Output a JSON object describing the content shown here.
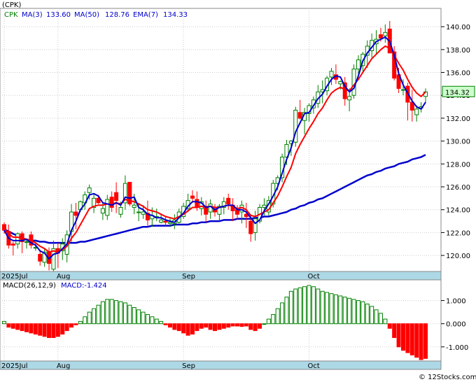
{
  "symbol_label": "(CPK)",
  "legend": {
    "price": {
      "label": "CPK",
      "color": "#008000"
    },
    "ma3": {
      "label": "MA(3)",
      "value": "133.60",
      "color": "#0000cc"
    },
    "ma50": {
      "label": "MA(50)",
      "value": "128.76",
      "color": "#0000cc"
    },
    "ema7": {
      "label": "EMA(7)",
      "value": "134.33",
      "color": "#0000cc"
    }
  },
  "last_price_badge": "134.32",
  "macd_legend": {
    "title": "MACD(26,12,9)",
    "value_label": "MACD:-1.424"
  },
  "watermark": "© 12Stocks.com",
  "colors": {
    "up": "#008000",
    "down": "#ff0000",
    "ma50_line": "#0000cc",
    "ma3_line": "#0000cc",
    "ema7_line": "#ff0000",
    "band": "#add8e6",
    "grid": "#cccccc"
  },
  "chart_data": [
    {
      "type": "candlestick",
      "ylim": [
        118.6,
        141.6
      ],
      "y_ticks": [
        "140.00",
        "138.00",
        "136.00",
        "134.00",
        "132.00",
        "130.00",
        "128.00",
        "126.00",
        "124.00",
        "122.00",
        "120.00"
      ],
      "x_labels": [
        "2025Jul",
        "Aug",
        "Sep",
        "Oct"
      ],
      "x_label_index": [
        0,
        12,
        40,
        68
      ],
      "ohlc": [
        [
          122.7,
          122.9,
          121.9,
          122.2
        ],
        [
          122.1,
          122.7,
          120.6,
          120.9
        ],
        [
          121.0,
          121.2,
          120.0,
          120.9
        ],
        [
          121.0,
          122.0,
          120.6,
          121.9
        ],
        [
          121.9,
          122.1,
          120.2,
          121.2
        ],
        [
          121.2,
          121.5,
          120.6,
          121.2
        ],
        [
          121.8,
          122.1,
          120.6,
          120.9
        ],
        [
          120.7,
          121.3,
          120.4,
          120.7
        ],
        [
          120.1,
          120.5,
          119.1,
          119.5
        ],
        [
          119.4,
          120.6,
          119.0,
          120.3
        ],
        [
          120.3,
          120.7,
          118.7,
          119.3
        ],
        [
          118.8,
          121.3,
          118.5,
          120.6
        ],
        [
          120.6,
          121.1,
          118.9,
          120.2
        ],
        [
          120.4,
          121.5,
          119.6,
          121.0
        ],
        [
          120.1,
          122.2,
          119.4,
          121.8
        ],
        [
          122.1,
          124.5,
          121.2,
          123.8
        ],
        [
          123.8,
          124.6,
          122.3,
          123.5
        ],
        [
          124.0,
          124.8,
          123.8,
          124.7
        ],
        [
          124.6,
          125.6,
          124.0,
          125.3
        ],
        [
          125.5,
          126.2,
          124.9,
          125.9
        ],
        [
          124.2,
          125.4,
          123.7,
          125.0
        ],
        [
          125.0,
          125.3,
          124.5,
          124.6
        ],
        [
          123.7,
          124.6,
          123.1,
          124.1
        ],
        [
          123.5,
          125.3,
          123.1,
          124.9
        ],
        [
          125.1,
          125.6,
          123.8,
          124.2
        ],
        [
          125.5,
          126.4,
          123.7,
          124.8
        ],
        [
          123.6,
          124.7,
          123.3,
          124.2
        ],
        [
          124.6,
          127.0,
          124.0,
          126.3
        ],
        [
          126.4,
          126.4,
          124.3,
          124.5
        ],
        [
          124.2,
          125.4,
          123.6,
          124.4
        ],
        [
          123.8,
          124.6,
          123.0,
          123.8
        ],
        [
          123.6,
          124.4,
          123.2,
          123.8
        ],
        [
          123.7,
          124.8,
          122.6,
          123.1
        ],
        [
          123.2,
          124.2,
          122.5,
          123.5
        ],
        [
          123.3,
          124.1,
          123.0,
          123.4
        ],
        [
          122.9,
          123.6,
          122.8,
          123.1
        ],
        [
          123.0,
          123.4,
          122.6,
          122.9
        ],
        [
          122.8,
          123.3,
          122.5,
          122.9
        ],
        [
          122.8,
          123.6,
          122.3,
          123.1
        ],
        [
          122.9,
          124.1,
          122.8,
          123.8
        ],
        [
          123.4,
          124.6,
          123.2,
          124.3
        ],
        [
          124.1,
          125.4,
          123.8,
          124.8
        ],
        [
          125.2,
          125.7,
          124.6,
          125.0
        ],
        [
          124.9,
          125.6,
          123.9,
          124.2
        ],
        [
          124.1,
          125.1,
          123.5,
          124.7
        ],
        [
          124.3,
          124.8,
          122.9,
          123.6
        ],
        [
          123.8,
          124.9,
          123.2,
          124.5
        ],
        [
          124.0,
          124.5,
          123.4,
          123.8
        ],
        [
          123.6,
          124.5,
          123.0,
          124.3
        ],
        [
          124.2,
          125.1,
          123.6,
          124.7
        ],
        [
          125.0,
          125.4,
          124.0,
          124.5
        ],
        [
          124.4,
          125.0,
          123.0,
          123.9
        ],
        [
          124.0,
          124.4,
          123.1,
          123.6
        ],
        [
          123.8,
          124.8,
          122.8,
          124.4
        ],
        [
          123.6,
          124.6,
          122.4,
          123.4
        ],
        [
          123.0,
          123.6,
          121.2,
          121.9
        ],
        [
          122.0,
          123.9,
          121.3,
          123.2
        ],
        [
          123.0,
          124.5,
          122.8,
          124.2
        ],
        [
          124.2,
          125.0,
          123.5,
          124.4
        ],
        [
          123.8,
          125.2,
          123.5,
          124.8
        ],
        [
          124.5,
          126.6,
          124.2,
          126.3
        ],
        [
          126.3,
          127.0,
          125.7,
          126.8
        ],
        [
          126.8,
          128.9,
          126.4,
          128.6
        ],
        [
          128.6,
          130.1,
          127.9,
          129.7
        ],
        [
          129.8,
          130.1,
          128.7,
          130.0
        ],
        [
          129.9,
          133.0,
          129.5,
          132.7
        ],
        [
          132.5,
          133.6,
          131.9,
          132.0
        ],
        [
          131.8,
          132.9,
          130.6,
          132.5
        ],
        [
          132.4,
          133.3,
          131.7,
          133.1
        ],
        [
          132.9,
          133.9,
          132.4,
          133.6
        ],
        [
          133.3,
          134.9,
          132.9,
          134.3
        ],
        [
          134.3,
          135.3,
          133.3,
          134.5
        ],
        [
          134.4,
          135.7,
          134.0,
          135.5
        ],
        [
          135.6,
          136.4,
          134.9,
          136.1
        ],
        [
          135.8,
          136.7,
          135.0,
          135.4
        ],
        [
          135.0,
          135.3,
          134.5,
          135.2
        ],
        [
          135.1,
          135.6,
          133.1,
          133.7
        ],
        [
          133.6,
          134.6,
          132.6,
          133.9
        ],
        [
          134.0,
          136.7,
          133.7,
          136.3
        ],
        [
          136.3,
          137.5,
          135.7,
          137.1
        ],
        [
          136.6,
          137.8,
          136.0,
          137.6
        ],
        [
          137.5,
          138.8,
          136.4,
          138.3
        ],
        [
          137.9,
          139.4,
          137.3,
          138.8
        ],
        [
          138.5,
          139.7,
          137.6,
          138.9
        ],
        [
          139.3,
          139.9,
          138.7,
          139.0
        ],
        [
          139.2,
          140.2,
          138.6,
          139.5
        ],
        [
          139.8,
          140.5,
          138.0,
          137.7
        ],
        [
          137.8,
          138.3,
          135.3,
          135.5
        ],
        [
          135.8,
          136.4,
          134.2,
          134.6
        ],
        [
          134.5,
          135.4,
          134.0,
          134.5
        ],
        [
          134.8,
          135.1,
          131.8,
          133.4
        ],
        [
          133.4,
          134.5,
          131.7,
          132.7
        ],
        [
          132.3,
          133.1,
          131.7,
          132.8
        ],
        [
          132.9,
          133.4,
          132.5,
          133.0
        ],
        [
          133.9,
          134.6,
          133.4,
          134.3
        ]
      ],
      "series": [
        {
          "name": "MA(3)",
          "values": [
            122.2,
            121.5,
            121.3,
            121.3,
            121.3,
            121.4,
            121.1,
            120.9,
            120.4,
            120.2,
            119.7,
            120.1,
            120.2,
            120.6,
            121.0,
            122.2,
            123.0,
            124.0,
            124.5,
            125.3,
            125.4,
            125.2,
            124.6,
            124.5,
            124.4,
            124.6,
            124.4,
            125.1,
            125.0,
            125.1,
            124.2,
            124.0,
            123.6,
            123.5,
            123.3,
            123.3,
            123.1,
            123.0,
            122.9,
            123.3,
            123.7,
            124.3,
            124.7,
            124.7,
            124.6,
            124.2,
            124.3,
            124.0,
            124.2,
            124.3,
            124.4,
            124.4,
            124.0,
            124.0,
            123.8,
            123.3,
            122.8,
            123.1,
            123.9,
            124.5,
            125.2,
            126.0,
            127.2,
            128.4,
            129.4,
            130.8,
            131.6,
            132.4,
            132.5,
            133.1,
            133.7,
            134.1,
            134.8,
            135.4,
            135.7,
            135.6,
            134.8,
            134.3,
            134.6,
            135.7,
            137.0,
            137.7,
            138.2,
            138.7,
            138.9,
            139.1,
            138.7,
            137.5,
            135.9,
            134.9,
            134.2,
            133.5,
            133.0,
            132.8,
            133.4
          ]
        },
        {
          "name": "EMA(7)",
          "values": [
            122.3,
            121.9,
            121.6,
            121.6,
            121.5,
            121.4,
            121.3,
            121.1,
            120.8,
            120.6,
            120.3,
            120.4,
            120.3,
            120.5,
            120.8,
            121.5,
            122.0,
            122.7,
            123.4,
            124.1,
            124.3,
            124.4,
            124.4,
            124.5,
            124.5,
            124.6,
            124.5,
            124.9,
            124.8,
            124.7,
            124.5,
            124.3,
            124.0,
            123.9,
            123.8,
            123.6,
            123.4,
            123.3,
            123.2,
            123.4,
            123.6,
            123.9,
            124.2,
            124.2,
            124.3,
            124.2,
            124.3,
            124.2,
            124.2,
            124.3,
            124.4,
            124.3,
            124.1,
            124.2,
            124.0,
            123.5,
            123.4,
            123.6,
            123.8,
            124.0,
            124.6,
            125.2,
            126.0,
            126.9,
            127.7,
            128.9,
            129.7,
            130.4,
            131.1,
            131.7,
            132.4,
            132.9,
            133.6,
            134.2,
            134.5,
            134.7,
            134.5,
            134.4,
            134.9,
            135.4,
            136.0,
            136.6,
            137.2,
            137.6,
            138.0,
            138.3,
            138.1,
            137.5,
            136.8,
            136.2,
            135.4,
            134.7,
            134.2,
            133.9,
            134.3
          ]
        },
        {
          "name": "MA(50)",
          "values": [
            122.3,
            122.1,
            121.9,
            121.7,
            121.5,
            121.4,
            121.3,
            121.3,
            121.2,
            121.2,
            121.1,
            121.1,
            121.1,
            121.1,
            121.1,
            121.1,
            121.1,
            121.2,
            121.2,
            121.3,
            121.4,
            121.5,
            121.6,
            121.7,
            121.8,
            121.9,
            122.0,
            122.1,
            122.2,
            122.3,
            122.4,
            122.5,
            122.5,
            122.6,
            122.6,
            122.6,
            122.6,
            122.6,
            122.7,
            122.7,
            122.7,
            122.7,
            122.8,
            122.8,
            122.9,
            122.9,
            123.0,
            123.0,
            123.0,
            123.1,
            123.1,
            123.1,
            123.2,
            123.2,
            123.2,
            123.2,
            123.3,
            123.3,
            123.4,
            123.4,
            123.5,
            123.6,
            123.7,
            123.8,
            124.0,
            124.1,
            124.3,
            124.4,
            124.6,
            124.7,
            124.9,
            125.0,
            125.2,
            125.4,
            125.6,
            125.8,
            126.0,
            126.2,
            126.4,
            126.6,
            126.8,
            127.0,
            127.1,
            127.3,
            127.4,
            127.6,
            127.7,
            127.8,
            128.0,
            128.1,
            128.2,
            128.4,
            128.5,
            128.6,
            128.8
          ]
        }
      ]
    },
    {
      "type": "bar",
      "title": "MACD(26,12,9)",
      "ylim": [
        -1.55,
        1.35
      ],
      "y_ticks": [
        "1.000",
        "0.000",
        "-1.000"
      ],
      "x_labels": [
        "2025Jul",
        "Aug",
        "Sep",
        "Oct"
      ],
      "x_label_index": [
        0,
        12,
        40,
        68
      ],
      "values": [
        0.1,
        -0.15,
        -0.2,
        -0.25,
        -0.3,
        -0.35,
        -0.4,
        -0.45,
        -0.5,
        -0.55,
        -0.6,
        -0.6,
        -0.55,
        -0.45,
        -0.3,
        -0.15,
        -0.05,
        0.1,
        0.3,
        0.5,
        0.65,
        0.8,
        0.95,
        1.05,
        1.05,
        1.0,
        0.95,
        0.9,
        0.8,
        0.7,
        0.6,
        0.5,
        0.4,
        0.3,
        0.2,
        0.1,
        -0.05,
        -0.15,
        -0.25,
        -0.3,
        -0.4,
        -0.5,
        -0.45,
        -0.3,
        -0.2,
        -0.15,
        -0.25,
        -0.3,
        -0.25,
        -0.2,
        -0.15,
        -0.1,
        -0.1,
        -0.12,
        -0.1,
        -0.25,
        -0.3,
        -0.2,
        0.0,
        0.2,
        0.4,
        0.65,
        0.9,
        1.15,
        1.4,
        1.5,
        1.55,
        1.6,
        1.65,
        1.6,
        1.5,
        1.4,
        1.35,
        1.3,
        1.25,
        1.2,
        1.15,
        1.1,
        1.05,
        1.0,
        0.95,
        0.85,
        0.75,
        0.6,
        0.45,
        0.2,
        -0.2,
        -0.6,
        -1.0,
        -1.15,
        -1.25,
        -1.35,
        -1.45,
        -1.55,
        -1.5
      ]
    }
  ]
}
